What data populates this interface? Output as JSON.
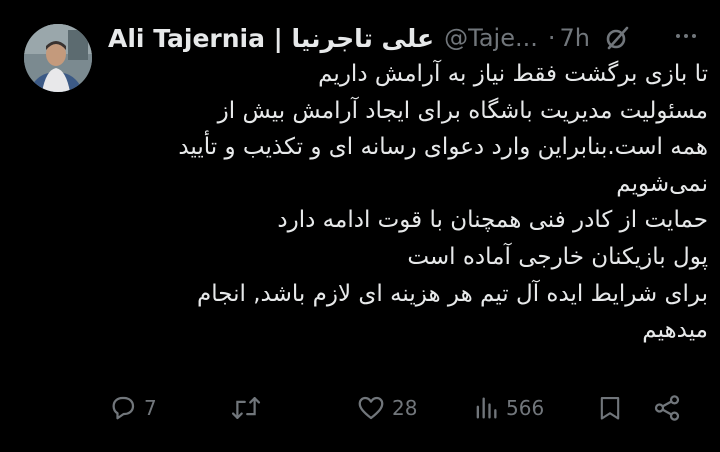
{
  "tweet": {
    "author_name": "Ali Tajernia | علی تاجرنیا",
    "handle": "@Taje...",
    "separator": "·",
    "time": "7h",
    "lines": [
      "تا بازی برگشت فقط نیاز به آرامش داریم",
      "مسئولیت  مدیریت باشگاه برای ایجاد آرامش بیش از",
      "همه است.بنابراین وارد دعوای رسانه ای و تکذیب و تأیید",
      "نمی‌شویم",
      "حمایت از کادر فنی همچنان با قوت ادامه دارد",
      "پول بازیکنان خارجی آماده است",
      "برای شرایط ایده آل تیم هر هزینه ای لازم باشد, انجام",
      "میدهیم"
    ]
  },
  "actions": {
    "replies": "7",
    "retweets": "",
    "likes": "28",
    "views": "566"
  },
  "icons": {
    "more": "more-icon",
    "grok": "grok-icon",
    "reply": "reply-icon",
    "retweet": "retweet-icon",
    "like": "heart-icon",
    "views": "views-icon",
    "bookmark": "bookmark-icon",
    "share": "share-icon"
  },
  "colors": {
    "background": "#000000",
    "text": "#e7e9ea",
    "muted": "#71767b"
  }
}
